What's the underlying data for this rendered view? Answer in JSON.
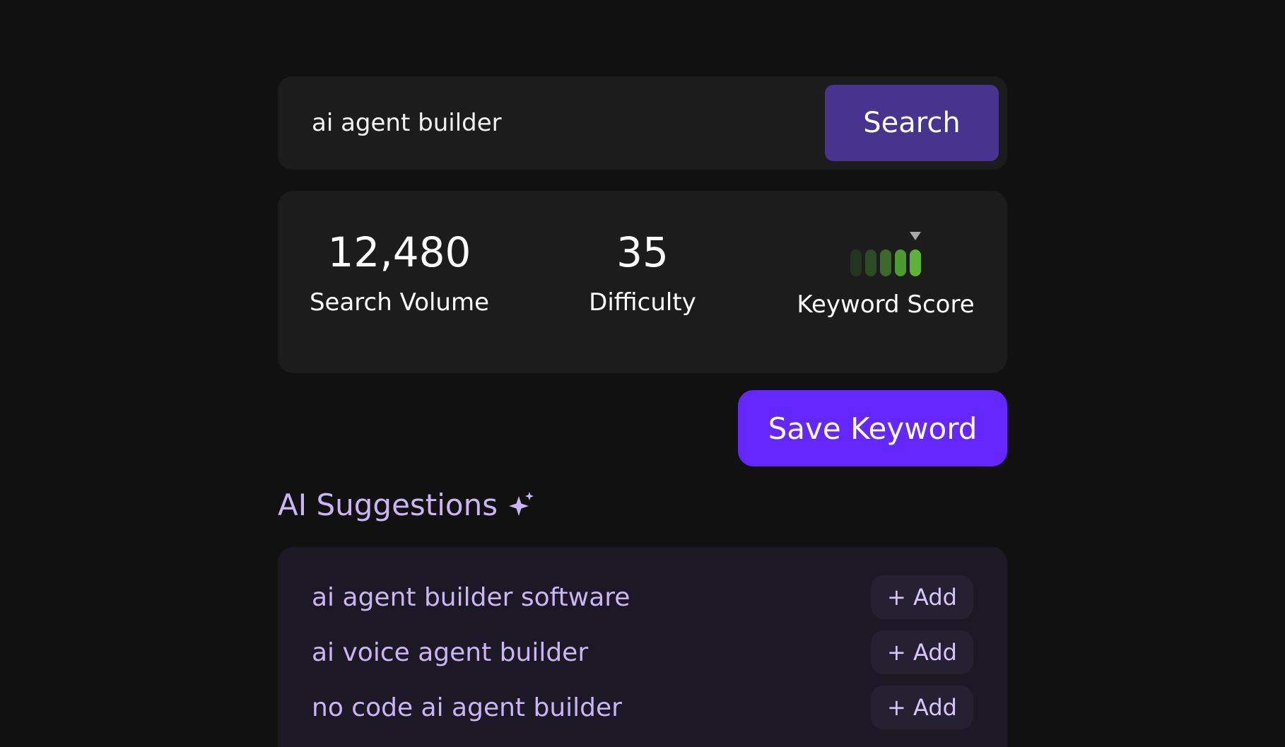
{
  "search": {
    "value": "ai agent builder",
    "button_label": "Search"
  },
  "stats": {
    "search_volume": {
      "value": "12,480",
      "label": "Search Volume"
    },
    "difficulty": {
      "value": "35",
      "label": "Difficulty"
    },
    "keyword_score": {
      "label": "Keyword Score",
      "level": 5,
      "max_level": 5,
      "bar_colors": [
        "#24351f",
        "#2e4a27",
        "#3b6a2c",
        "#4e9a32",
        "#5cb338"
      ],
      "pointer_color": "#a8a8a8"
    }
  },
  "save_button_label": "Save Keyword",
  "suggestions": {
    "title": "AI Suggestions",
    "icon": "sparkle-icon",
    "items": [
      {
        "text": "ai agent builder software",
        "add_label": "+ Add"
      },
      {
        "text": "ai voice agent builder",
        "add_label": "+ Add"
      },
      {
        "text": "no code ai agent builder",
        "add_label": "+ Add"
      }
    ]
  },
  "colors": {
    "background": "#111111",
    "card": "#1c1c1c",
    "search_button": "#48338f",
    "save_button": "#6427ff",
    "accent_text": "#cbb5f4",
    "suggestions_card": "#1c1826"
  }
}
